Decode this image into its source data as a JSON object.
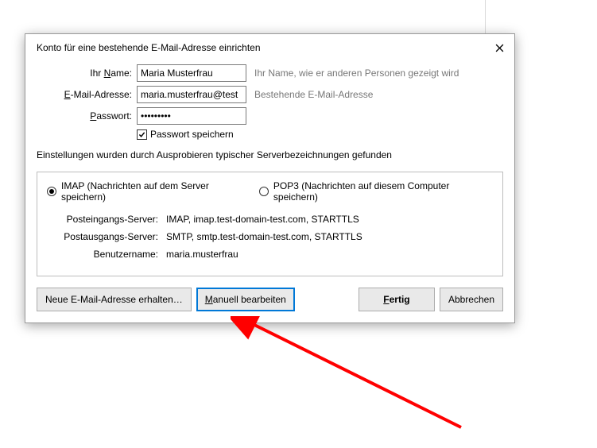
{
  "dialog": {
    "title": "Konto für eine bestehende E-Mail-Adresse einrichten",
    "form": {
      "name_label_pre": "Ihr ",
      "name_label_ul": "N",
      "name_label_post": "ame:",
      "name_value": "Maria Musterfrau",
      "name_hint": "Ihr Name, wie er anderen Personen gezeigt wird",
      "email_label_pre": "",
      "email_label_ul": "E",
      "email_label_post": "-Mail-Adresse:",
      "email_value": "maria.musterfrau@test",
      "email_hint": "Bestehende E-Mail-Adresse",
      "password_label_pre": "",
      "password_label_ul": "P",
      "password_label_post": "asswort:",
      "password_value": "•••••••••",
      "remember_label": "Passwort speichern",
      "remember_checked": true
    },
    "status": "Einstellungen wurden durch Ausprobieren typischer Serverbezeichnungen gefunden",
    "protocols": {
      "imap_label": "IMAP (Nachrichten auf dem Server speichern)",
      "pop3_label": "POP3 (Nachrichten auf diesem Computer speichern)",
      "selected": "imap"
    },
    "details": {
      "incoming_label": "Posteingangs-Server:",
      "incoming_value": "IMAP, imap.test-domain-test.com, STARTTLS",
      "outgoing_label": "Postausgangs-Server:",
      "outgoing_value": "SMTP, smtp.test-domain-test.com, STARTTLS",
      "username_label": "Benutzername:",
      "username_value": "maria.musterfrau"
    },
    "buttons": {
      "new_address": "Neue E-Mail-Adresse erhalten…",
      "manual_pre": "",
      "manual_ul": "M",
      "manual_post": "anuell bearbeiten",
      "done_pre": "",
      "done_ul": "F",
      "done_post": "ertig",
      "cancel": "Abbrechen"
    }
  }
}
